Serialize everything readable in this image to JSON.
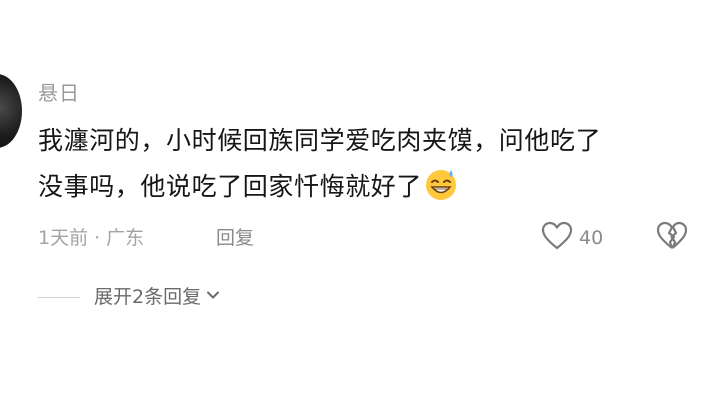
{
  "comment": {
    "username": "悬日",
    "text_line1": "我瀍河的，小时候回族同学爱吃肉夹馍，问他吃了",
    "text_line2": "没事吗，他说吃了回家忏悔就好了",
    "emoji": "grinning-face-with-sweat-icon",
    "time": "1天前",
    "separator": "·",
    "location": "广东",
    "reply_label": "回复",
    "like_count": "40",
    "expand_label": "展开2条回复"
  }
}
